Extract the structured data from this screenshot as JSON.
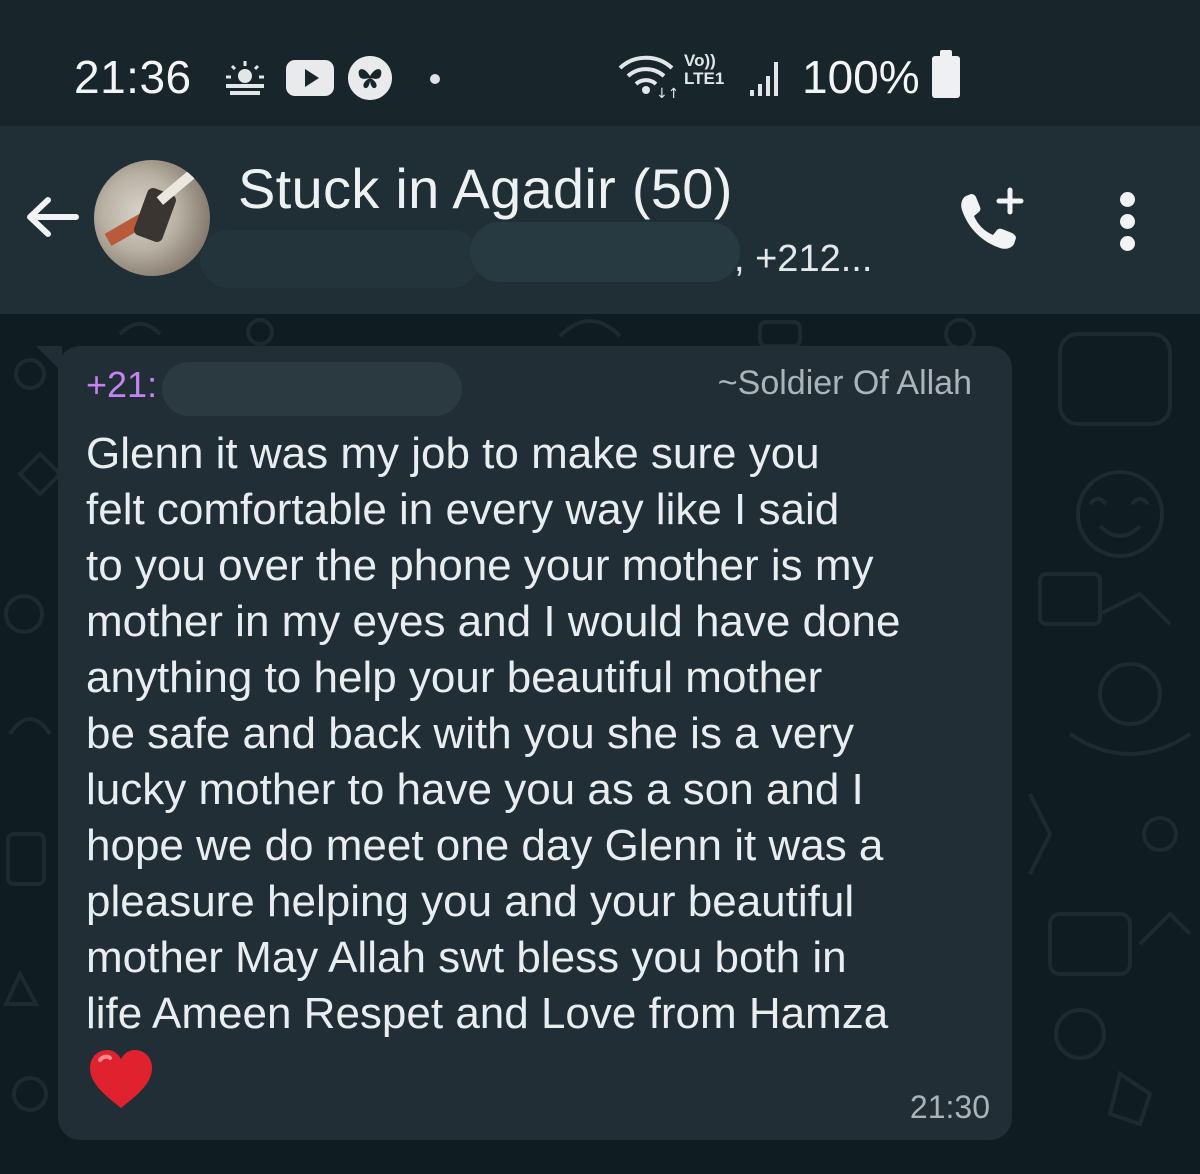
{
  "status_bar": {
    "time": "21:36",
    "network_label": "Vo))\nLTE1",
    "battery": "100%",
    "icons": [
      "weather-icon",
      "youtube-icon",
      "butterfly-icon",
      "notification-dot",
      "wifi-icon",
      "signal-icon",
      "battery-icon"
    ]
  },
  "header": {
    "title": "Stuck in Agadir (50)",
    "subtitle": ", +212...",
    "icons": [
      "back-arrow-icon",
      "group-avatar",
      "add-call-icon",
      "more-options-icon"
    ]
  },
  "message": {
    "sender": "+21:",
    "alias": "~Soldier Of Allah",
    "text": "Glenn it was my job to make sure you\nfelt comfortable in every way like I said\nto you over the phone your mother is my\nmother in my eyes and I would have done\nanything to help your beautiful mother\nbe safe and back with you she is a very\nlucky mother to have you as a son and I\nhope we do meet one day Glenn it was a\npleasure helping you and your beautiful\nmother May Allah swt bless you both in\nlife Ameen Respet and Love from Hamza",
    "emoji": "heart-emoji",
    "time": "21:30"
  },
  "colors": {
    "background": "#0e1b1f",
    "header": "#202f36",
    "bubble": "#212e35",
    "sender": "#c383f0",
    "text": "#e9edef"
  }
}
